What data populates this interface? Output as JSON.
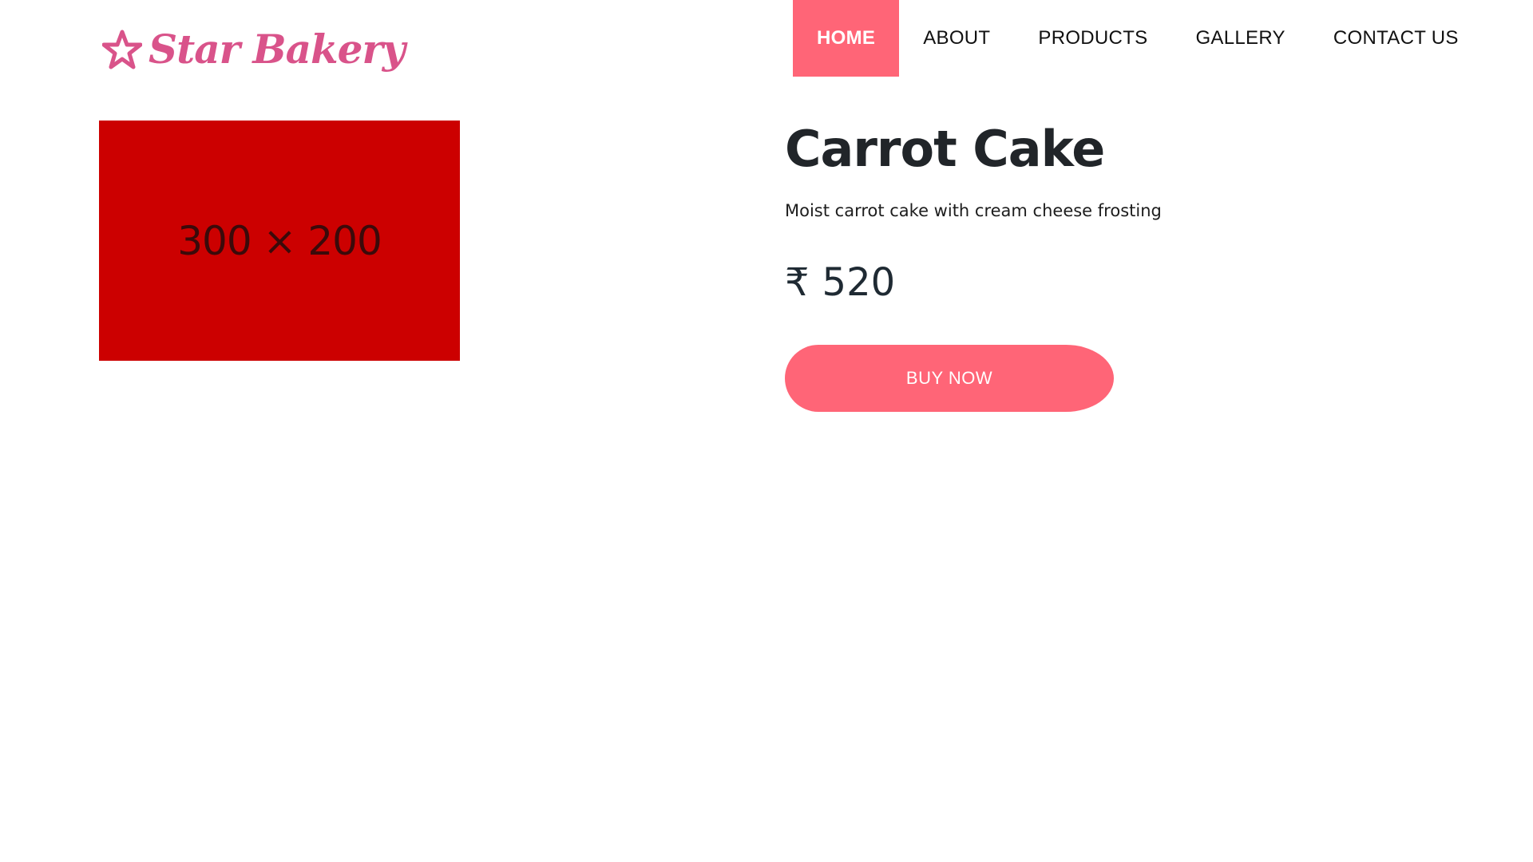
{
  "colors": {
    "accent": "#ff6577",
    "logo": "#d9538a",
    "image_placeholder": "#cc0000",
    "heading": "#212529"
  },
  "brand": {
    "icon": "star-icon",
    "name": "Star Bakery"
  },
  "nav": {
    "items": [
      {
        "label": "HOME",
        "active": true
      },
      {
        "label": "ABOUT",
        "active": false
      },
      {
        "label": "PRODUCTS",
        "active": false
      },
      {
        "label": "GALLERY",
        "active": false
      },
      {
        "label": "CONTACT US",
        "active": false
      }
    ]
  },
  "product": {
    "image_label": "300 × 200",
    "title": "Carrot Cake",
    "description": "Moist carrot cake with cream cheese frosting",
    "currency_symbol": "₹",
    "price": "520",
    "buy_label": "BUY NOW"
  }
}
